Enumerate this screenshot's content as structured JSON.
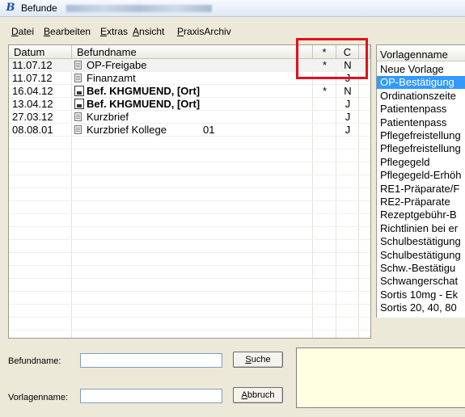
{
  "window": {
    "title": "Befunde"
  },
  "menu": {
    "items": [
      {
        "first": "D",
        "rest": "atei"
      },
      {
        "first": "B",
        "rest": "earbeiten"
      },
      {
        "first": "E",
        "rest": "xtras"
      },
      {
        "first": "A",
        "rest": "nsicht"
      },
      {
        "first": "P",
        "rest": "raxisArchiv"
      }
    ]
  },
  "findings_list": {
    "headers": {
      "date": "Datum",
      "name": "Befundname",
      "star": "*",
      "c": "C"
    },
    "rows": [
      {
        "date": "11.07.12",
        "icon": "document-icon",
        "name": "OP-Freigabe",
        "extra": "",
        "star": "*",
        "c": "N",
        "bold": false
      },
      {
        "date": "11.07.12",
        "icon": "document-icon",
        "name": "Finanzamt",
        "extra": "",
        "star": "",
        "c": "J",
        "bold": false
      },
      {
        "date": "16.04.12",
        "icon": "disk-icon",
        "name": "Bef. KHGMUEND, [Ort]",
        "extra": "",
        "star": "*",
        "c": "N",
        "bold": true
      },
      {
        "date": "13.04.12",
        "icon": "disk-icon",
        "name": "Bef. KHGMUEND, [Ort]",
        "extra": "",
        "star": "",
        "c": "J",
        "bold": true
      },
      {
        "date": "27.03.12",
        "icon": "document-icon",
        "name": "Kurzbrief",
        "extra": "",
        "star": "",
        "c": "J",
        "bold": false
      },
      {
        "date": "08.08.01",
        "icon": "document-icon",
        "name": "Kurzbrief Kollege",
        "extra": "01",
        "star": "",
        "c": "J",
        "bold": false
      }
    ]
  },
  "templates_list": {
    "header": "Vorlagenname",
    "items": [
      "Neue Vorlage",
      "OP-Bestätigung",
      "Ordinationszeite",
      "Patientenpass",
      "Patientenpass",
      "Pflegefreistellung",
      "Pflegefreistellung",
      "Pflegegeld",
      "Pflegegeld-Erhöh",
      "RE1-Präparate/F",
      "RE2-Präparate",
      "Rezeptgebühr-B",
      "Richtlinien bei er",
      "Schulbestätigung",
      "Schulbestätigung",
      "Schw.-Bestätigu",
      "Schwangerschat",
      "Sortis 10mg - Ek",
      "Sortis 20, 40, 80"
    ],
    "selected_index": 1
  },
  "search": {
    "findings_label": "Befundname:",
    "findings_value": "",
    "templates_label": "Vorlagenname:",
    "templates_value": "",
    "search_button": {
      "first": "S",
      "rest": "uche"
    },
    "cancel_button": {
      "first": "A",
      "rest": "bbruch"
    }
  },
  "colors": {
    "selection": "#3399ff",
    "highlight_box": "#e3101a",
    "preview_bg": "#ffffe1"
  }
}
